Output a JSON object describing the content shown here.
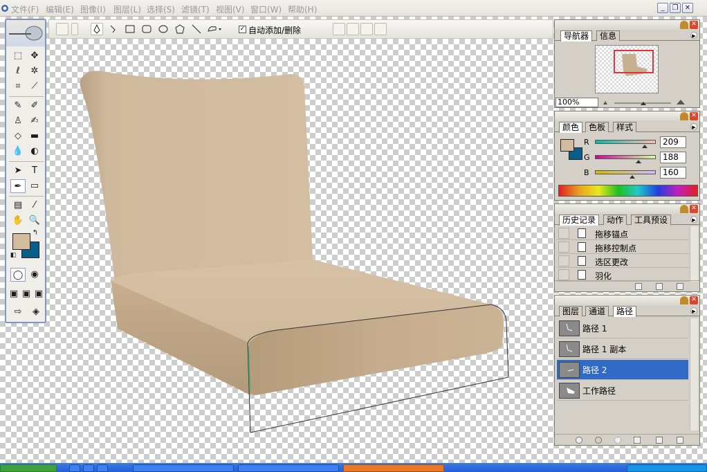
{
  "menu": {
    "items": [
      "文件(F)",
      "编辑(E)",
      "图像(I)",
      "图层(L)",
      "选择(S)",
      "滤镜(T)",
      "视图(V)",
      "窗口(W)",
      "帮助(H)"
    ]
  },
  "options_bar": {
    "auto_add_delete_label": "自动添加/删除",
    "auto_add_delete_checked": true
  },
  "toolbox": {
    "foreground_color": "#d1bca0",
    "background_color": "#0b5d8c"
  },
  "navigator_panel": {
    "tabs": [
      "导航器",
      "信息"
    ],
    "zoom": "100%"
  },
  "color_panel": {
    "tabs": [
      "颜色",
      "色板",
      "样式"
    ],
    "channels": [
      {
        "label": "R",
        "value": "209"
      },
      {
        "label": "G",
        "value": "188"
      },
      {
        "label": "B",
        "value": "160"
      }
    ]
  },
  "history_panel": {
    "tabs": [
      "历史记录",
      "动作",
      "工具预设"
    ],
    "items": [
      "拖移锚点",
      "拖移控制点",
      "选区更改",
      "羽化"
    ]
  },
  "paths_panel": {
    "tabs": [
      "图层",
      "通道",
      "路径"
    ],
    "items": [
      "路径 1",
      "路径 1 副本",
      "路径 2",
      "工作路径"
    ],
    "selected_index": 2
  },
  "colors": {
    "chair": "#d1bca0",
    "selection": "#316ac5",
    "taskbar": "#245edb"
  }
}
